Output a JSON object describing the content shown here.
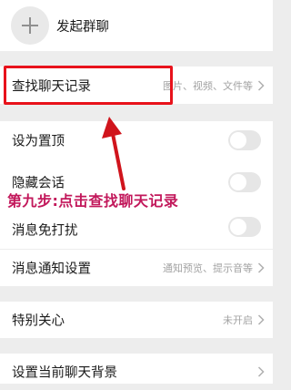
{
  "header": {
    "create_group_label": "发起群聊"
  },
  "rows": {
    "search_history": {
      "label": "查找聊天记录",
      "value": "图片、视频、文件等"
    },
    "pin_chat": {
      "label": "设为置顶"
    },
    "hide_chat": {
      "label": "隐藏会话"
    },
    "mute": {
      "label": "消息免打扰"
    },
    "notification_settings": {
      "label": "消息通知设置",
      "value": "通知预览、提示音等"
    },
    "special_care": {
      "label": "特别关心",
      "value": "未开启"
    },
    "chat_background": {
      "label": "设置当前聊天背景"
    }
  },
  "annotation": {
    "text": "第九步:点击查找聊天记录"
  },
  "colors": {
    "highlight": "#e8121b",
    "annotation": "#c2185b",
    "arrow": "#d0141c"
  }
}
